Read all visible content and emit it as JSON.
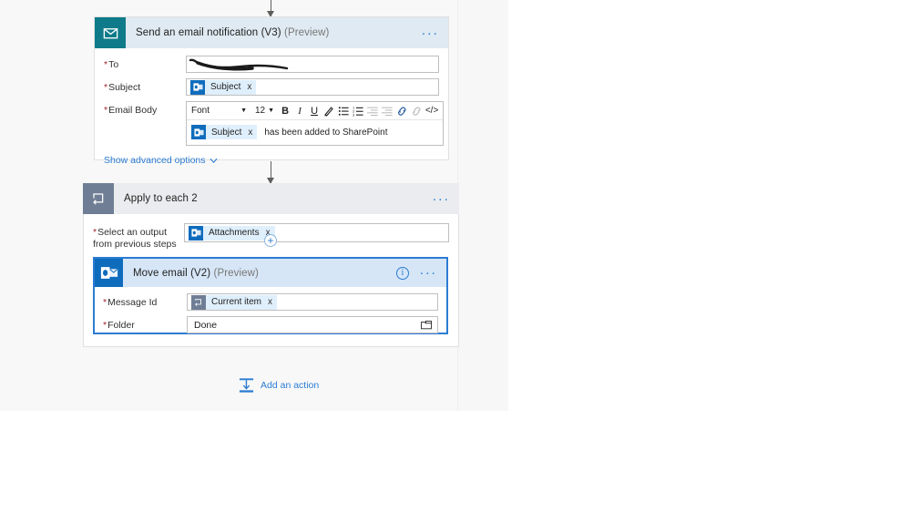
{
  "canvas": {
    "background_color": "#f7f7f7",
    "accent_color": "#2b7cd3"
  },
  "connectors": [
    {
      "name": "connector-top-to-email"
    },
    {
      "name": "connector-email-to-apply"
    }
  ],
  "cards": [
    {
      "id": "send-email-notification",
      "icon": "envelope-icon",
      "icon_color": "#0f7b8a",
      "title": "Send an email notification (V3)",
      "preview_tag": "(Preview)",
      "overflow_label": "...",
      "fields": [
        {
          "label": "To",
          "required": true,
          "type": "redacted-text",
          "value": ""
        },
        {
          "label": "Subject",
          "required": true,
          "type": "token",
          "token_icon": "office365-outlook-icon",
          "token_label": "Subject",
          "token_remove_label": "x"
        },
        {
          "label": "Email Body",
          "required": true,
          "type": "rich-text",
          "toolbar": {
            "font_name": "Font",
            "font_size": "12",
            "bold": "B",
            "italic": "I",
            "underline": "U",
            "font_color": "font-color-icon",
            "bulleted_list": "bulleted-list-icon",
            "numbered_list": "numbered-list-icon",
            "outdent": "outdent-icon",
            "indent": "indent-icon",
            "insert_link": "link-icon",
            "remove_link": "unlink-icon",
            "code_view": "</>"
          },
          "body_token_icon": "office365-outlook-icon",
          "body_token_label": "Subject",
          "body_token_remove_label": "x",
          "body_text": "has been added to SharePoint"
        }
      ],
      "advanced_options_label": "Show advanced options"
    },
    {
      "id": "apply-to-each-2",
      "icon": "loop-icon",
      "icon_color": "#6f7e95",
      "title": "Apply to each 2",
      "preview_tag": "",
      "overflow_label": "...",
      "fields": [
        {
          "label_line1": "Select an output",
          "label_line2": "from previous steps",
          "required": true,
          "type": "token",
          "token_icon": "office365-outlook-icon",
          "token_label": "Attachments",
          "token_remove_label": "x"
        }
      ],
      "add_step_label": "+"
    },
    {
      "id": "move-email-v2",
      "icon": "outlook-icon",
      "icon_color": "#0f6cbd",
      "title": "Move email (V2)",
      "preview_tag": "(Preview)",
      "info_label": "i",
      "overflow_label": "...",
      "selected": true,
      "fields": [
        {
          "label": "Message Id",
          "required": true,
          "type": "token",
          "token_icon": "loop-icon",
          "token_label": "Current item",
          "token_remove_label": "x"
        },
        {
          "label": "Folder",
          "required": true,
          "type": "folder-picker",
          "value": "Done",
          "picker_icon": "folder-icon"
        }
      ]
    }
  ],
  "add_action": {
    "icon": "add-action-icon",
    "label": "Add an action"
  }
}
